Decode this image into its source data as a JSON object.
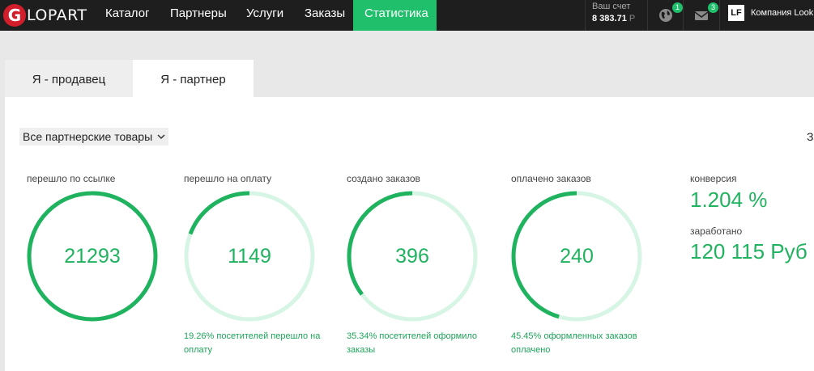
{
  "header": {
    "logo_letter": "G",
    "logo_text": "LOPART",
    "nav": [
      {
        "label": "Каталог"
      },
      {
        "label": "Партнеры"
      },
      {
        "label": "Услуги"
      },
      {
        "label": "Заказы"
      },
      {
        "label": "Статистика",
        "active": true
      }
    ],
    "account": {
      "label": "Ваш счет",
      "value": "8 383.71",
      "currency": "Р"
    },
    "globe_badge": "1",
    "mail_badge": "3",
    "company_logo": "LF",
    "company_name": "Компания Look"
  },
  "tabs": [
    {
      "label": "Я - продавец",
      "active": false
    },
    {
      "label": "Я - партнер",
      "active": true
    }
  ],
  "filter": {
    "label": "Все партнерские товары",
    "edge_char": "З"
  },
  "metrics": [
    {
      "label": "перешло по ссылке",
      "value": "21293",
      "fill": 1.0,
      "note": ""
    },
    {
      "label": "перешло на оплату",
      "value": "1149",
      "fill": 0.1926,
      "note": "19.26% посетителей перешло на оплату"
    },
    {
      "label": "создано заказов",
      "value": "396",
      "fill": 0.3534,
      "note": "35.34% посетителей оформило заказы"
    },
    {
      "label": "оплачено заказов",
      "value": "240",
      "fill": 0.4545,
      "note": "45.45% оформленных заказов оплачено"
    }
  ],
  "kpis": {
    "conversion_label": "конверсия",
    "conversion_value": "1.204 %",
    "earned_label": "заработано",
    "earned_value": "120 115 Руб"
  },
  "colors": {
    "accent": "#20bf6b",
    "ring_track": "#d6f5e4",
    "ring_fill": "#20b35f",
    "topbar": "#1e1e1e"
  }
}
